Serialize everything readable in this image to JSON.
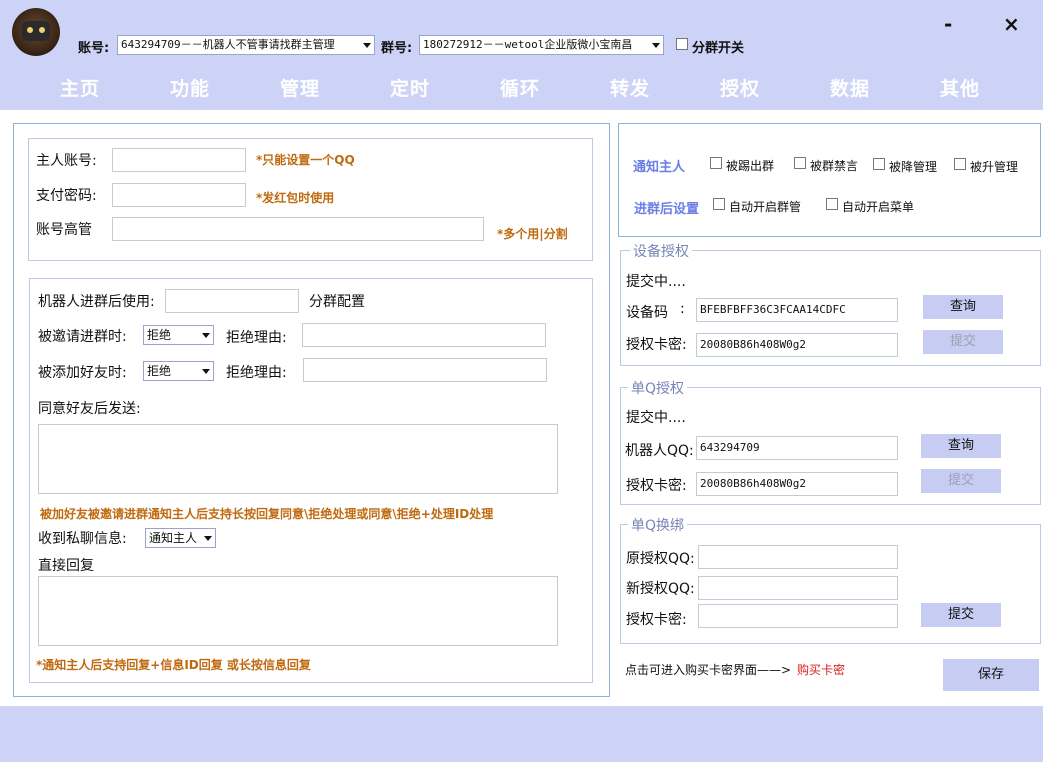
{
  "header": {
    "account_label": "账号:",
    "account_value": "643294709－－机器人不管事请找群主管理",
    "group_label": "群号:",
    "group_value": "180272912－－wetool企业版微小宝南昌",
    "split_toggle_label": "分群开关",
    "minimize": "-",
    "close": "×"
  },
  "nav": {
    "tabs": [
      "主页",
      "功能",
      "管理",
      "定时",
      "循环",
      "转发",
      "授权",
      "数据",
      "其他"
    ]
  },
  "owner": {
    "owner_account_label": "主人账号:",
    "owner_account_hint": "*只能设置一个QQ",
    "pay_password_label": "支付密码:",
    "pay_password_hint": "*发红包时使用",
    "admins_label": "账号高管",
    "admins_hint": "*多个用|分割"
  },
  "robot": {
    "after_join_label": "机器人进群后使用:",
    "group_config_label": "分群配置",
    "invited_label": "被邀请进群时:",
    "invited_value": "拒绝",
    "invited_reason_label": "拒绝理由:",
    "friend_label": "被添加好友时:",
    "friend_value": "拒绝",
    "friend_reason_label": "拒绝理由:",
    "after_agree_label": "同意好友后发送:",
    "invite_hint": "被加好友被邀请进群通知主人后支持长按回复同意\\拒绝处理或同意\\拒绝+处理ID处理",
    "private_msg_label": "收到私聊信息:",
    "private_msg_value": "通知主人",
    "direct_reply_label": "直接回复",
    "bottom_hint": "*通知主人后支持回复+信息ID回复 或长按信息回复"
  },
  "notify": {
    "notify_label": "通知主人",
    "kicked": "被踢出群",
    "muted": "被群禁言",
    "demoted": "被降管理",
    "promoted": "被升管理",
    "after_join_label": "进群后设置",
    "auto_manage": "自动开启群管",
    "auto_menu": "自动开启菜单"
  },
  "device_auth": {
    "title": "设备授权",
    "status": "提交中....",
    "device_code_label": "设备码",
    "device_code_colon": ":",
    "device_code_value": "BFEBFBFF36C3FCAA14CDFC",
    "query_button": "查询",
    "card_label": "授权卡密:",
    "card_value": "20080B86h408W0g2",
    "submit_button": "提交"
  },
  "single_auth": {
    "title": "单Q授权",
    "status": "提交中....",
    "robot_qq_label": "机器人QQ:",
    "robot_qq_value": "643294709",
    "query_button": "查询",
    "card_label": "授权卡密:",
    "card_value": "20080B86h408W0g2",
    "submit_button": "提交"
  },
  "rebind": {
    "title": "单Q换绑",
    "old_qq_label": "原授权QQ:",
    "new_qq_label": "新授权QQ:",
    "card_label": "授权卡密:",
    "submit_button": "提交"
  },
  "footer": {
    "buy_text": "点击可进入购买卡密界面——>",
    "buy_link": "购买卡密",
    "save_button": "保存"
  },
  "colors": {
    "nav_bg": "#ccd3f6",
    "button_bg": "#c7cdf2",
    "hint_orange": "#c06a10",
    "link_red": "#d8201e",
    "label_blue": "#6b7de6"
  }
}
